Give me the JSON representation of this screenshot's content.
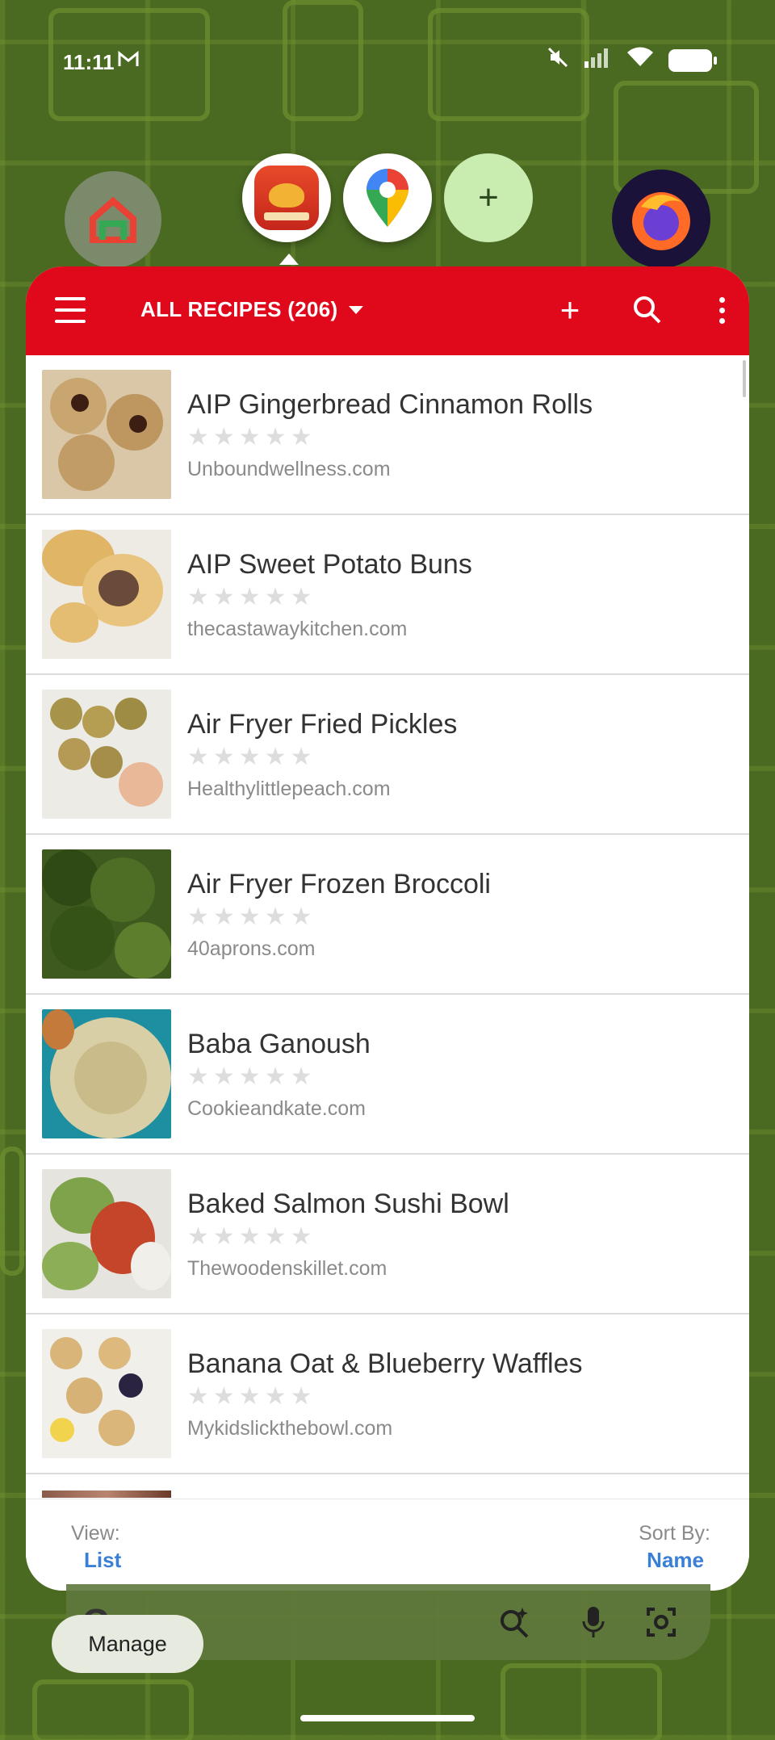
{
  "status_bar": {
    "time": "11:11",
    "mail_icon": "gmail-icon",
    "icons": [
      "mute-icon",
      "signal-icon",
      "wifi-icon",
      "battery-icon"
    ]
  },
  "bubbles": [
    {
      "name": "google-home-icon"
    },
    {
      "name": "paprika-icon",
      "label": "PAPRIKA"
    },
    {
      "name": "google-maps-icon"
    },
    {
      "name": "add-bubble-icon",
      "glyph": "+"
    },
    {
      "name": "firefox-icon"
    }
  ],
  "app_bar": {
    "title": "ALL RECIPES (206)",
    "add_glyph": "+",
    "accent": "#e0091b"
  },
  "recipes": [
    {
      "name": "AIP Gingerbread Cinnamon Rolls",
      "stars": "★★★★★",
      "source": "Unboundwellness.com"
    },
    {
      "name": "AIP Sweet Potato Buns",
      "stars": "★★★★★",
      "source": "thecastawaykitchen.com"
    },
    {
      "name": "Air Fryer Fried Pickles",
      "stars": "★★★★★",
      "source": "Healthylittlepeach.com"
    },
    {
      "name": "Air Fryer Frozen Broccoli",
      "stars": "★★★★★",
      "source": "40aprons.com"
    },
    {
      "name": "Baba Ganoush",
      "stars": "★★★★★",
      "source": "Cookieandkate.com"
    },
    {
      "name": "Baked Salmon Sushi Bowl",
      "stars": "★★★★★",
      "source": "Thewoodenskillet.com"
    },
    {
      "name": "Banana Oat & Blueberry Waffles",
      "stars": "★★★★★",
      "source": "Mykidslickthebowl.com"
    }
  ],
  "bottom_bar": {
    "view_label": "View:",
    "view_value": "List",
    "sort_label": "Sort By:",
    "sort_value": "Name",
    "link_color": "#3a7fd6"
  },
  "home": {
    "search_logo": "G",
    "manage_label": "Manage"
  }
}
